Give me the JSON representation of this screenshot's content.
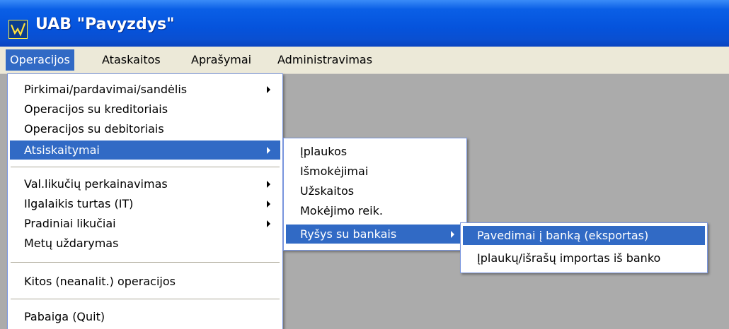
{
  "window": {
    "title": "UAB \"Pavyzdys\""
  },
  "menubar": [
    {
      "label": "Operacijos"
    },
    {
      "label": "Ataskaitos"
    },
    {
      "label": "Aprašymai"
    },
    {
      "label": "Administravimas"
    }
  ],
  "operacijos_menu": [
    {
      "label": "Pirkimai/pardavimai/sandėlis"
    },
    {
      "label": "Operacijos su kreditoriais"
    },
    {
      "label": "Operacijos su debitoriais"
    },
    {
      "label": "Atsiskaitymai"
    },
    {
      "label": "Val.likučių perkainavimas"
    },
    {
      "label": "Ilgalaikis turtas (IT)"
    },
    {
      "label": "Pradiniai likučiai"
    },
    {
      "label": "Metų uždarymas"
    },
    {
      "label": "Kitos (neanalit.) operacijos"
    },
    {
      "label": "Pabaiga (Quit)"
    }
  ],
  "atsiskaitymai_menu": [
    {
      "label": "Įplaukos"
    },
    {
      "label": "Išmokėjimai"
    },
    {
      "label": "Užskaitos"
    },
    {
      "label": "Mokėjimo reik."
    },
    {
      "label": "Ryšys su bankais"
    }
  ],
  "bankai_menu": [
    {
      "label": "Pavedimai į banką (eksportas)"
    },
    {
      "label": "Įplaukų/išrašų importas iš banko"
    }
  ],
  "colors": {
    "highlight": "#316ac5",
    "menu_bg": "#ffffff",
    "menubar_bg": "#ece9d8",
    "workspace_bg": "#ababab"
  }
}
